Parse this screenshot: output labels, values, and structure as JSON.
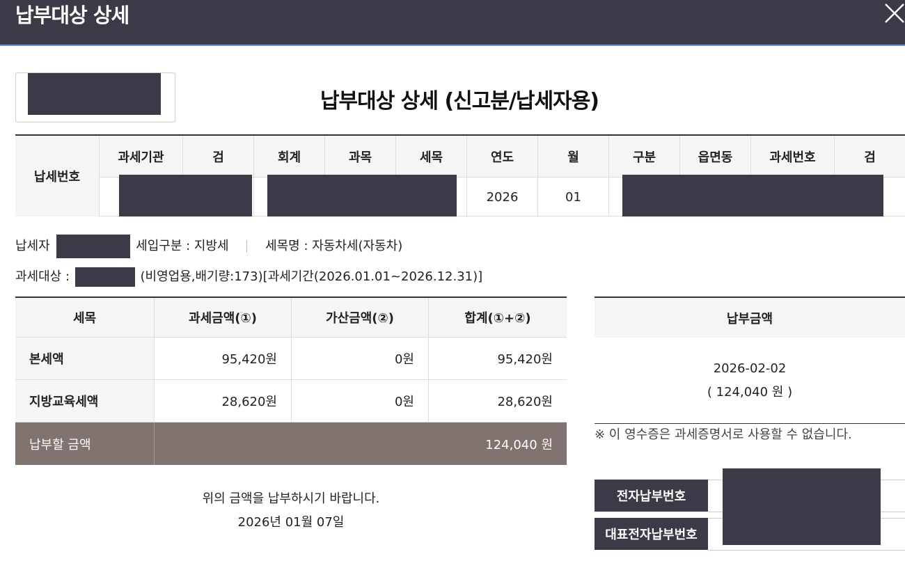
{
  "window": {
    "title": "납부대상 상세"
  },
  "document": {
    "title": "납부대상 상세 (신고분/납세자용)"
  },
  "tax_number": {
    "label": "납세번호",
    "columns": [
      "과세기관",
      "검",
      "회계",
      "과목",
      "세목",
      "연도",
      "월",
      "구분",
      "읍면동",
      "과세번호",
      "검"
    ],
    "values": {
      "year": "2026",
      "month": "01"
    }
  },
  "taxpayer": {
    "taxpayer_label": "납세자",
    "income_type": "세입구분 : 지방세",
    "tax_item_name": "세목명 : 자동차세(자동차)",
    "target_label": "과세대상 :",
    "target_detail": "(비영업용,배기량:173)[과세기간(2026.01.01~2026.12.31)]"
  },
  "amount_table": {
    "headers": [
      "세목",
      "과세금액(①)",
      "가산금액(②)",
      "합계(①+②)"
    ],
    "rows": [
      {
        "item": "본세액",
        "tax": "95,420원",
        "additional": "0원",
        "total": "95,420원"
      },
      {
        "item": "지방교육세액",
        "tax": "28,620원",
        "additional": "0원",
        "total": "28,620원"
      }
    ],
    "total_label": "납부할 금액",
    "total_value": "124,040 원"
  },
  "request": {
    "message": "위의 금액을 납부하시기 바랍니다.",
    "date": "2026년 01월 07일"
  },
  "payment": {
    "header": "납부금액",
    "due_date": "2026-02-02",
    "amount": "( 124,040 원 )",
    "notice": "※ 이 영수증은 과세증명서로 사용할 수 없습니다.",
    "e_payment_label": "전자납부번호",
    "rep_e_payment_label": "대표전자납부번호"
  },
  "icons": {
    "close": "close-icon"
  },
  "colors": {
    "titlebar": "#3a3b47",
    "mask": "#3a3b47",
    "total_row": "#817470",
    "accent_line": "#6b8fd6"
  }
}
